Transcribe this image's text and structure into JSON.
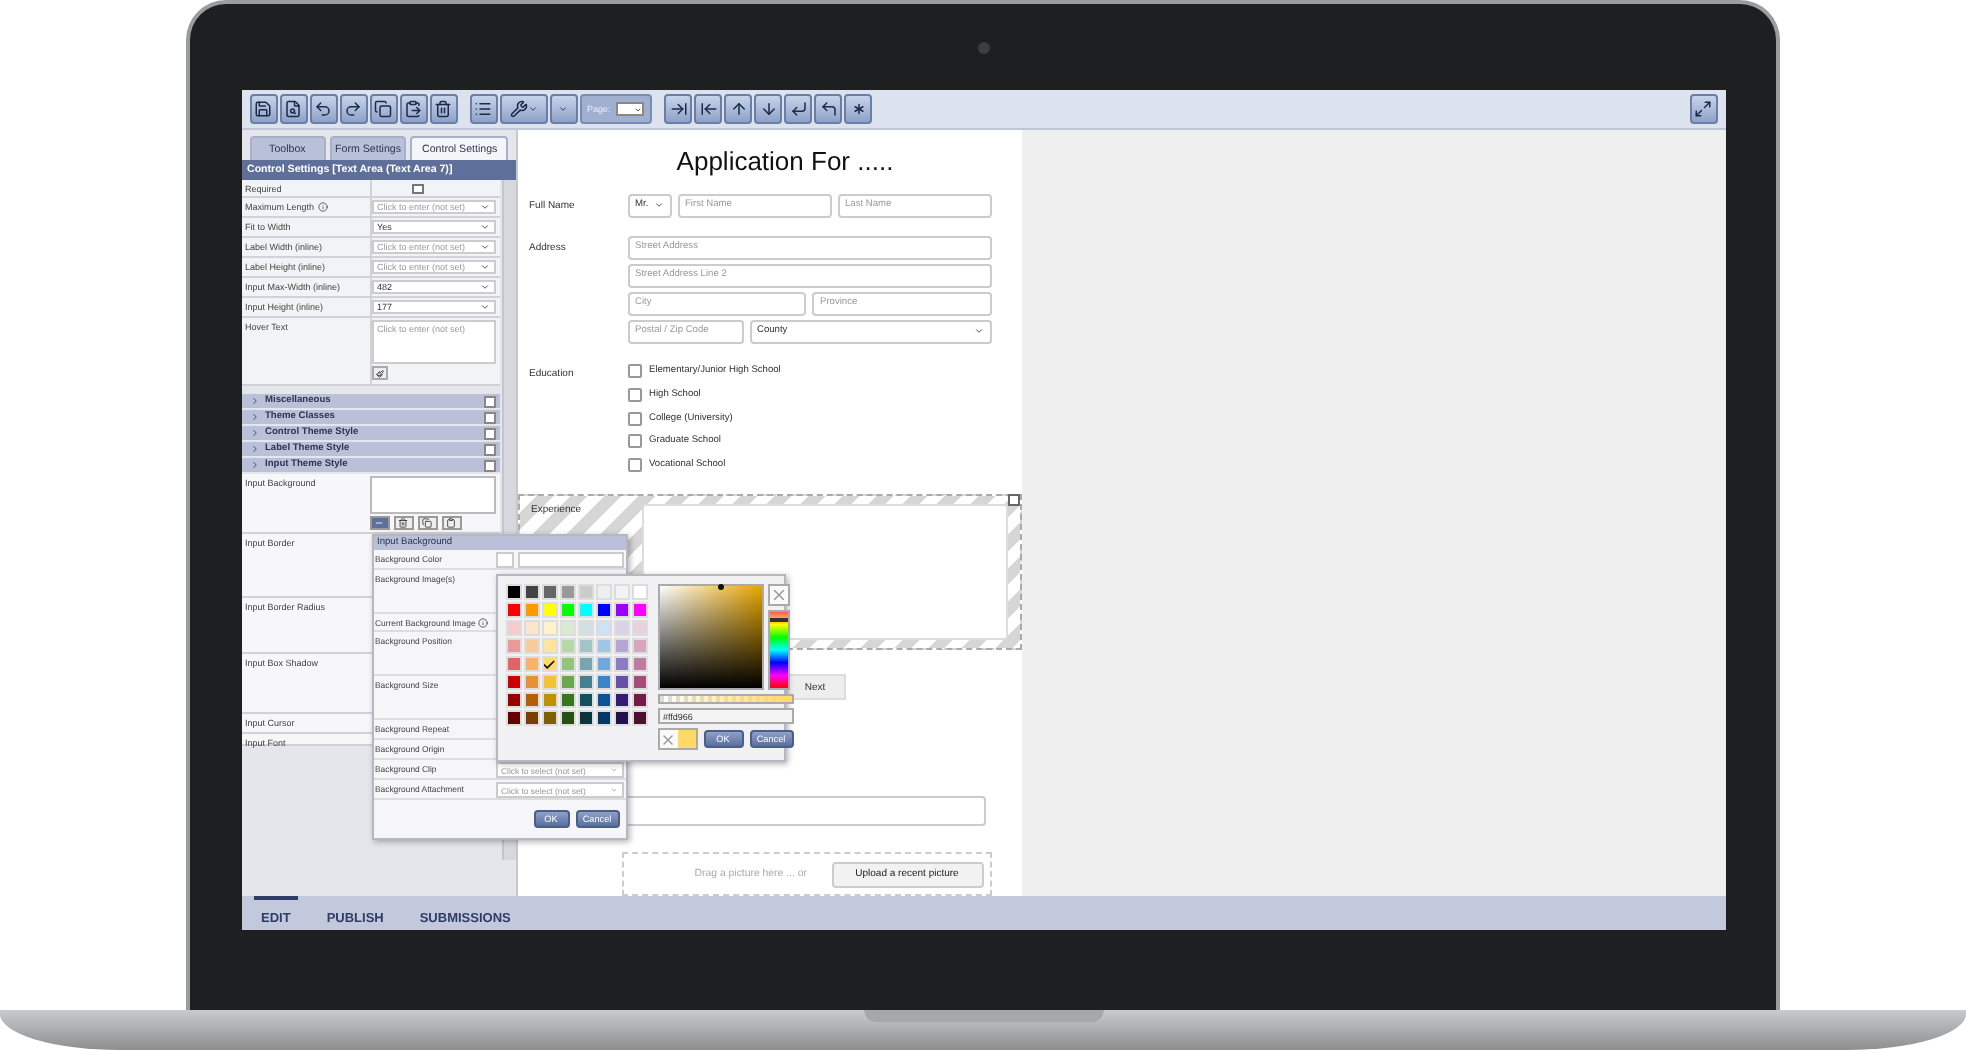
{
  "toolbar": {
    "page_label": "Page:"
  },
  "left_panel": {
    "tabs": [
      {
        "label": "Toolbox",
        "selected": false
      },
      {
        "label": "Form Settings",
        "selected": false
      },
      {
        "label": "Control Settings",
        "selected": true
      }
    ],
    "header": "Control Settings [Text Area (Text Area 7)]",
    "properties": [
      {
        "kind": "checkbox",
        "label": "Required",
        "checked": false
      },
      {
        "kind": "spinner",
        "label": "Maximum Length",
        "info": true,
        "placeholder": "Click to enter (not set)"
      },
      {
        "kind": "select",
        "label": "Fit to Width",
        "value": "Yes"
      },
      {
        "kind": "spinner",
        "label": "Label Width (inline)",
        "placeholder": "Click to enter (not set)"
      },
      {
        "kind": "spinner",
        "label": "Label Height (inline)",
        "placeholder": "Click to enter (not set)"
      },
      {
        "kind": "spinner",
        "label": "Input Max-Width (inline)",
        "value": "482"
      },
      {
        "kind": "spinner",
        "label": "Input Height (inline)",
        "value": "177"
      },
      {
        "kind": "textarea",
        "label": "Hover Text",
        "placeholder": "Click to enter (not set)"
      }
    ],
    "sections": [
      {
        "label": "Miscellaneous",
        "checked": false
      },
      {
        "label": "Theme Classes",
        "checked": false
      },
      {
        "label": "Control Theme Style",
        "checked": false
      },
      {
        "label": "Label Theme Style",
        "checked": false
      },
      {
        "label": "Input Theme Style",
        "checked": false
      }
    ],
    "style_properties": [
      {
        "kind": "editor",
        "label": "Input Background"
      },
      {
        "kind": "plain",
        "label": "Input Border"
      },
      {
        "kind": "plain",
        "label": "Input Border Radius"
      },
      {
        "kind": "plain",
        "label": "Input Box Shadow"
      },
      {
        "kind": "plain",
        "label": "Input Cursor"
      },
      {
        "kind": "plain",
        "label": "Input Font"
      }
    ]
  },
  "background_popup": {
    "title": "Input Background",
    "rows": [
      {
        "kind": "color",
        "label": "Background Color"
      },
      {
        "kind": "tall",
        "label": "Background Image(s)"
      },
      {
        "kind": "info",
        "label": "Current Background Image"
      },
      {
        "kind": "tall",
        "label": "Background Position"
      },
      {
        "kind": "tall",
        "label": "Background Size"
      },
      {
        "kind": "plain",
        "label": "Background Repeat"
      },
      {
        "kind": "plain",
        "label": "Background Origin"
      },
      {
        "kind": "select",
        "label": "Background Clip",
        "placeholder": "Click to select (not set)"
      },
      {
        "kind": "select",
        "label": "Background Attachment",
        "placeholder": "Click to select (not set)"
      }
    ],
    "ok": "OK",
    "cancel": "Cancel"
  },
  "color_picker": {
    "swatch_rows": [
      [
        {
          "color": "#000000",
          "selected": false
        },
        {
          "color": "#434343",
          "selected": false
        },
        {
          "color": "#666666",
          "selected": false
        },
        {
          "color": "#999999",
          "selected": false
        },
        {
          "color": "#cccccc",
          "selected": false
        },
        {
          "color": "#efefef",
          "selected": false
        },
        {
          "color": "#f3f3f3",
          "selected": false
        },
        {
          "color": "#ffffff",
          "selected": false
        }
      ],
      [
        {
          "color": "#ff0000",
          "selected": false
        },
        {
          "color": "#ff9900",
          "selected": false
        },
        {
          "color": "#ffff00",
          "selected": false
        },
        {
          "color": "#00ff00",
          "selected": false
        },
        {
          "color": "#00ffff",
          "selected": false
        },
        {
          "color": "#0000ff",
          "selected": false
        },
        {
          "color": "#9900ff",
          "selected": false
        },
        {
          "color": "#ff00ff",
          "selected": false
        }
      ],
      [
        {
          "color": "#f4cccc",
          "selected": false
        },
        {
          "color": "#fce5cd",
          "selected": false
        },
        {
          "color": "#fff2cc",
          "selected": false
        },
        {
          "color": "#d9ead3",
          "selected": false
        },
        {
          "color": "#d0e0e3",
          "selected": false
        },
        {
          "color": "#cfe2f3",
          "selected": false
        },
        {
          "color": "#d9d2e9",
          "selected": false
        },
        {
          "color": "#ead1dc",
          "selected": false
        }
      ],
      [
        {
          "color": "#ea9999",
          "selected": false
        },
        {
          "color": "#f9cb9c",
          "selected": false
        },
        {
          "color": "#ffe599",
          "selected": false
        },
        {
          "color": "#b6d7a8",
          "selected": false
        },
        {
          "color": "#a2c4c9",
          "selected": false
        },
        {
          "color": "#9fc5e8",
          "selected": false
        },
        {
          "color": "#b4a7d6",
          "selected": false
        },
        {
          "color": "#d5a6bd",
          "selected": false
        }
      ],
      [
        {
          "color": "#e06666",
          "selected": false
        },
        {
          "color": "#f6b26b",
          "selected": false
        },
        {
          "color": "#ffd966",
          "selected": true
        },
        {
          "color": "#93c47d",
          "selected": false
        },
        {
          "color": "#76a5af",
          "selected": false
        },
        {
          "color": "#6fa8dc",
          "selected": false
        },
        {
          "color": "#8e7cc3",
          "selected": false
        },
        {
          "color": "#c27ba0",
          "selected": false
        }
      ],
      [
        {
          "color": "#cc0000",
          "selected": false
        },
        {
          "color": "#e69138",
          "selected": false
        },
        {
          "color": "#f1c232",
          "selected": false
        },
        {
          "color": "#6aa84f",
          "selected": false
        },
        {
          "color": "#45818e",
          "selected": false
        },
        {
          "color": "#3d85c6",
          "selected": false
        },
        {
          "color": "#674ea7",
          "selected": false
        },
        {
          "color": "#a64d79",
          "selected": false
        }
      ],
      [
        {
          "color": "#990000",
          "selected": false
        },
        {
          "color": "#b45f06",
          "selected": false
        },
        {
          "color": "#bf9000",
          "selected": false
        },
        {
          "color": "#38761d",
          "selected": false
        },
        {
          "color": "#134f5c",
          "selected": false
        },
        {
          "color": "#0b5394",
          "selected": false
        },
        {
          "color": "#351c75",
          "selected": false
        },
        {
          "color": "#741b47",
          "selected": false
        }
      ],
      [
        {
          "color": "#660000",
          "selected": false
        },
        {
          "color": "#783f04",
          "selected": false
        },
        {
          "color": "#7f6000",
          "selected": false
        },
        {
          "color": "#274e13",
          "selected": false
        },
        {
          "color": "#0c343d",
          "selected": false
        },
        {
          "color": "#073763",
          "selected": false
        },
        {
          "color": "#20124d",
          "selected": false
        },
        {
          "color": "#4c1130",
          "selected": false
        }
      ]
    ],
    "hue": {
      "level": 0.12
    },
    "hex": "#ffd966",
    "alpha": {
      "level": 1
    },
    "ok": "OK",
    "cancel": "Cancel"
  },
  "form": {
    "title": "Application For .....",
    "full_name": {
      "label": "Full Name",
      "prefix": "Mr.",
      "first_placeholder": "First Name",
      "last_placeholder": "Last Name"
    },
    "address": {
      "label": "Address",
      "line1": "Street Address",
      "line2": "Street Address Line 2",
      "city": "City",
      "province": "Province",
      "postal": "Postal / Zip Code",
      "county": "County"
    },
    "education": {
      "label": "Education",
      "options": [
        {
          "label": "Elementary/Junior High School",
          "checked": false
        },
        {
          "label": "High School",
          "checked": false
        },
        {
          "label": "College (University)",
          "checked": false
        },
        {
          "label": "Graduate School",
          "checked": false
        },
        {
          "label": "Vocational School",
          "checked": false
        }
      ]
    },
    "experience": {
      "label": "Experience"
    },
    "next": "Next",
    "upload": {
      "hint": "Drag a picture here ... or",
      "button": "Upload a recent picture"
    }
  },
  "bottom_tabs": [
    {
      "label": "EDIT",
      "selected": true
    },
    {
      "label": "PUBLISH",
      "selected": false
    },
    {
      "label": "SUBMISSIONS",
      "selected": false
    }
  ]
}
